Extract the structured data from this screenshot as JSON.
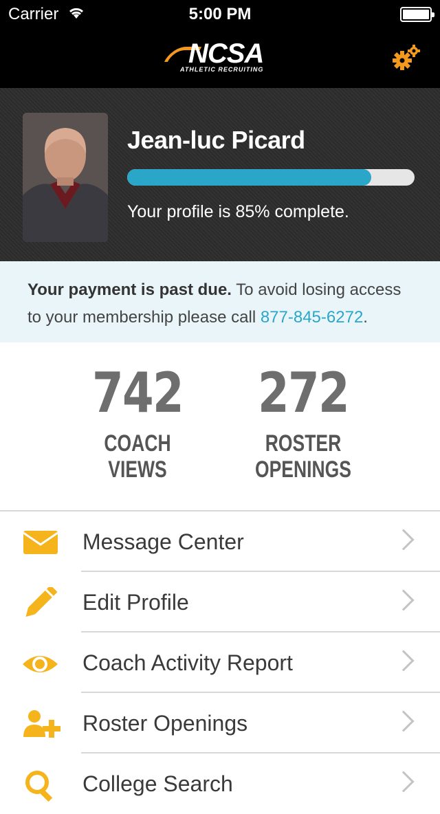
{
  "status_bar": {
    "carrier": "Carrier",
    "time": "5:00 PM"
  },
  "nav": {
    "logo_text": "NCSA",
    "logo_subtext": "ATHLETIC RECRUITING",
    "accent_color": "#f39a1e"
  },
  "profile": {
    "name": "Jean-luc Picard",
    "progress": 0.85,
    "progress_text": "Your profile is 85% complete.",
    "progress_color": "#2aa6c9"
  },
  "notice": {
    "bold_text": "Your payment is past due.",
    "text": " To avoid losing access to your membership please call ",
    "phone": "877-845-6272",
    "end": "."
  },
  "stats": [
    {
      "value": "742",
      "label_line1": "COACH",
      "label_line2": "VIEWS"
    },
    {
      "value": "272",
      "label_line1": "ROSTER",
      "label_line2": "OPENINGS"
    }
  ],
  "menu": [
    {
      "label": "Message Center",
      "icon": "envelope-icon"
    },
    {
      "label": "Edit Profile",
      "icon": "pencil-icon"
    },
    {
      "label": "Coach Activity Report",
      "icon": "eye-icon"
    },
    {
      "label": "Roster Openings",
      "icon": "add-user-icon"
    },
    {
      "label": "College Search",
      "icon": "search-icon"
    }
  ]
}
